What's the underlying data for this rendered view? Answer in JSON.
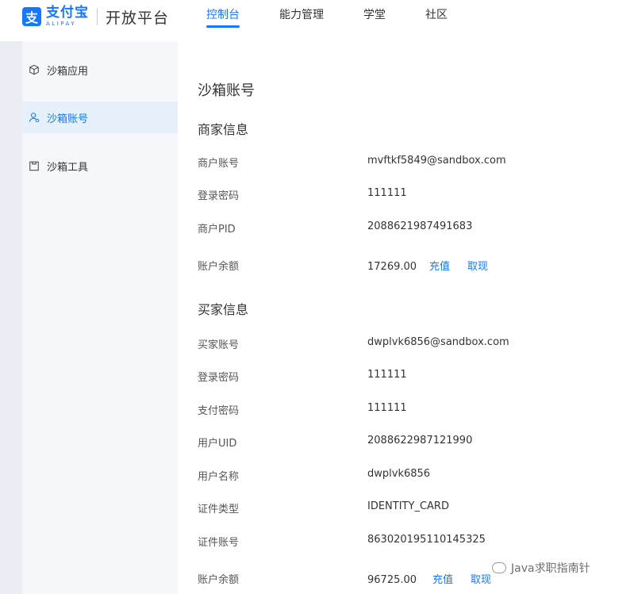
{
  "header": {
    "logo_cn": "支付宝",
    "logo_en": "ALIPAY",
    "product": "开放平台",
    "nav": [
      {
        "label": "控制台"
      },
      {
        "label": "能力管理"
      },
      {
        "label": "学堂"
      },
      {
        "label": "社区"
      }
    ],
    "accent_color": "#1677ff"
  },
  "sidebar": {
    "items": [
      {
        "label": "沙箱应用",
        "icon": "cube-icon"
      },
      {
        "label": "沙箱账号",
        "icon": "user-icon"
      },
      {
        "label": "沙箱工具",
        "icon": "tool-icon"
      }
    ]
  },
  "main": {
    "title": "沙箱账号",
    "merchant": {
      "title": "商家信息",
      "rows": [
        {
          "label": "商户账号",
          "value": "mvftkf5849@sandbox.com"
        },
        {
          "label": "登录密码",
          "value": "111111"
        },
        {
          "label": "商户PID",
          "value": "2088621987491683"
        },
        {
          "label": "账户余额",
          "value": "17269.00"
        }
      ],
      "recharge": "充值",
      "withdraw": "取现"
    },
    "buyer": {
      "title": "买家信息",
      "rows": [
        {
          "label": "买家账号",
          "value": "dwplvk6856@sandbox.com"
        },
        {
          "label": "登录密码",
          "value": "111111"
        },
        {
          "label": "支付密码",
          "value": "111111"
        },
        {
          "label": "用户UID",
          "value": "2088622987121990"
        },
        {
          "label": "用户名称",
          "value": "dwplvk6856"
        },
        {
          "label": "证件类型",
          "value": "IDENTITY_CARD"
        },
        {
          "label": "证件账号",
          "value": "863020195110145325"
        },
        {
          "label": "账户余额",
          "value": "96725.00"
        }
      ],
      "recharge": "充值",
      "withdraw": "取现"
    }
  },
  "watermark": {
    "text": "Java求职指南针"
  }
}
